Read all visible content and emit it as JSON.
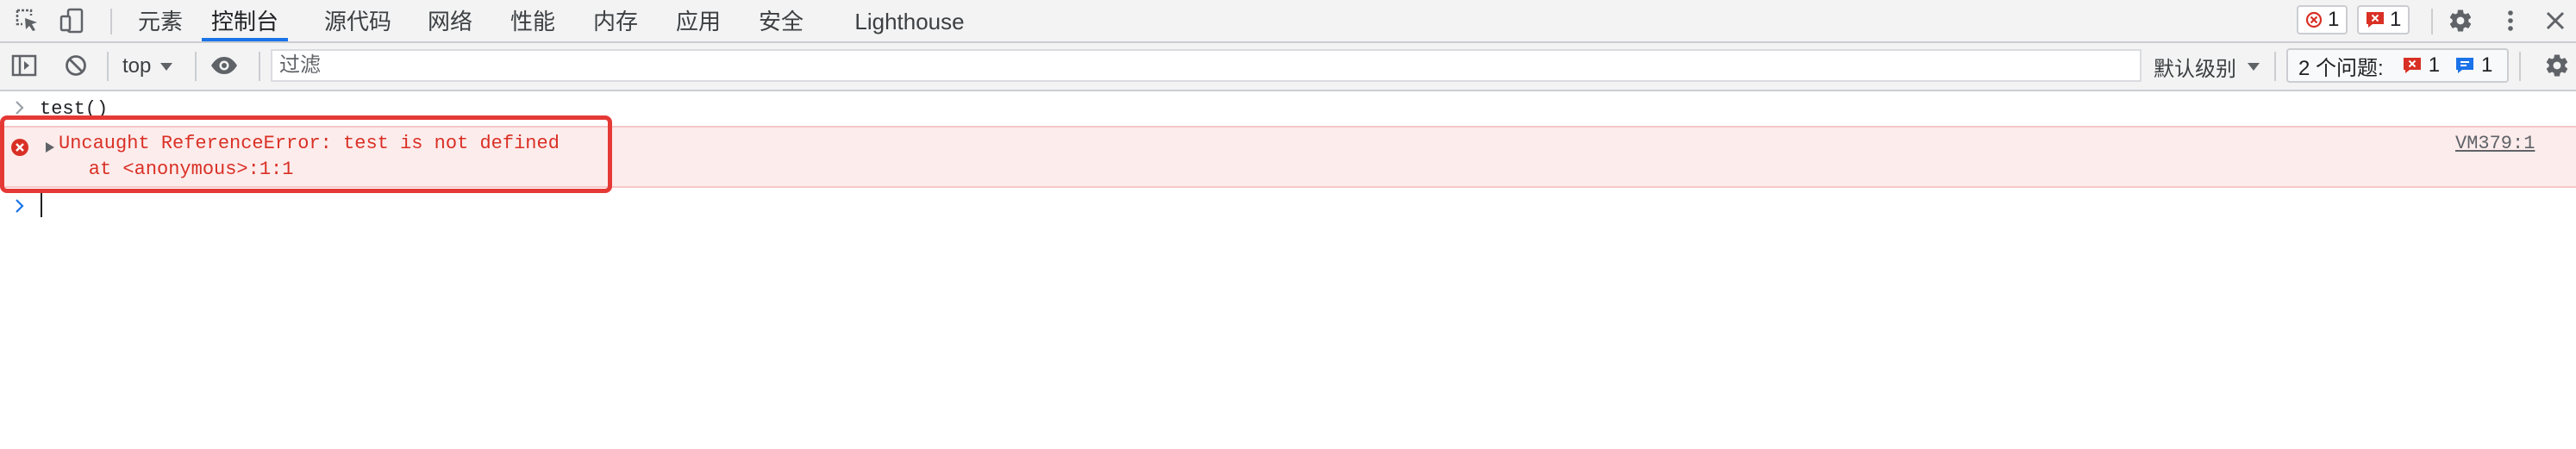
{
  "tabbar": {
    "tabs": [
      {
        "label": "元素"
      },
      {
        "label": "控制台",
        "active": true
      },
      {
        "label": "源代码"
      },
      {
        "label": "网络"
      },
      {
        "label": "性能"
      },
      {
        "label": "内存"
      },
      {
        "label": "应用"
      },
      {
        "label": "安全"
      },
      {
        "label": "Lighthouse"
      }
    ],
    "error_count": "1",
    "issue_count": "1"
  },
  "toolbar": {
    "context": "top",
    "filter_placeholder": "过滤",
    "log_levels": "默认级别",
    "issues_label": "2 个问题:",
    "issues_errors": "1",
    "issues_info": "1"
  },
  "console": {
    "input_command": "test()",
    "error_line1": "Uncaught ReferenceError: test is not defined",
    "error_line2": "    at <anonymous>:1:1",
    "error_source": "VM379:1"
  },
  "colors": {
    "accent": "#1a73e8",
    "error": "#d93025",
    "error_bg": "#fdecec",
    "highlight": "#e53935"
  },
  "icons": [
    "inspect-element-icon",
    "device-toggle-icon",
    "settings-icon",
    "more-icon",
    "close-icon",
    "sidebar-icon",
    "clear-console-icon",
    "eye-icon",
    "error-icon",
    "info-icon",
    "prompt-chevron-icon",
    "expand-triangle-icon"
  ]
}
